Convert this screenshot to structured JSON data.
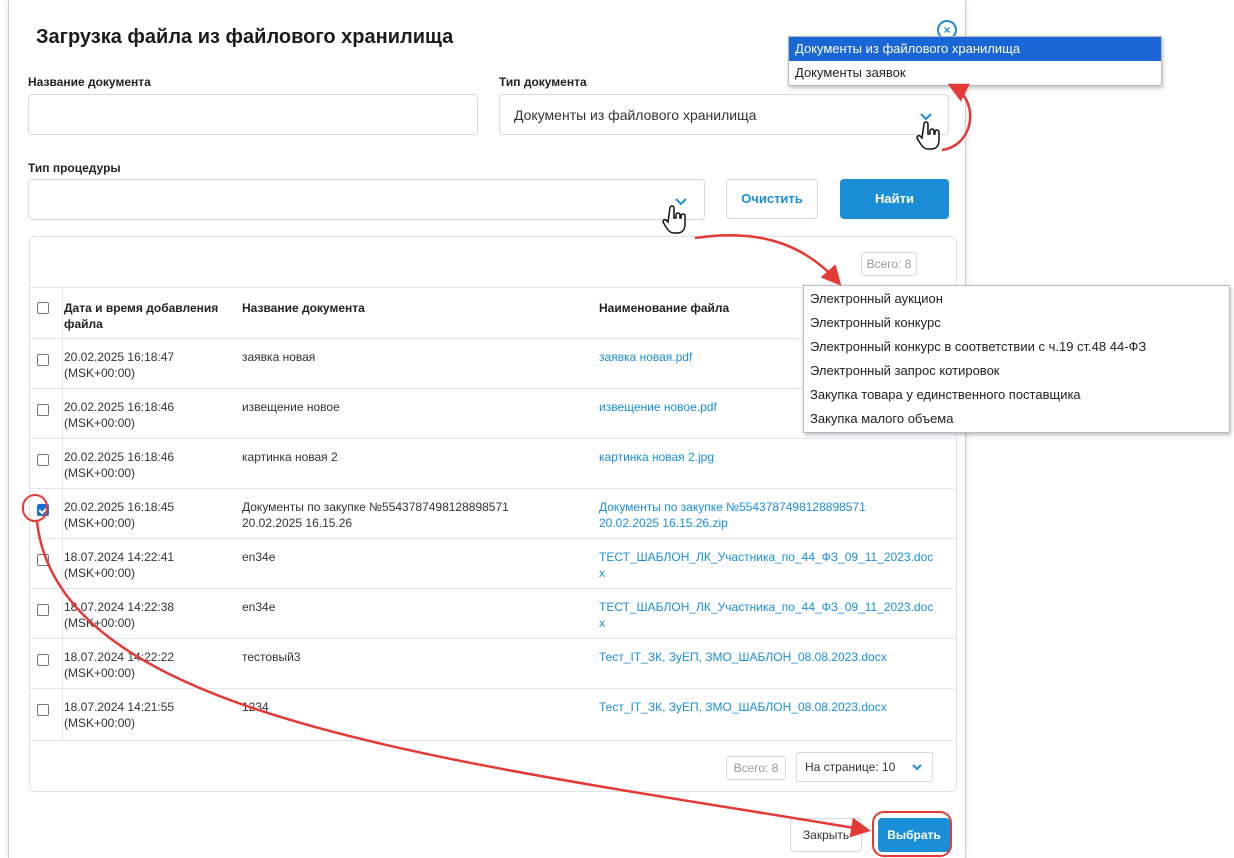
{
  "modal": {
    "title": "Загрузка файла из файлового хранилища",
    "close_icon": "close-circle-icon"
  },
  "filters": {
    "doc_name_label": "Название документа",
    "doc_name_value": "",
    "doc_type_label": "Тип документа",
    "doc_type_value": "Документы из файлового хранилища",
    "proc_type_label": "Тип процедуры",
    "proc_type_value": "",
    "clear_label": "Очистить",
    "find_label": "Найти"
  },
  "table": {
    "total_top": "Всего: 8",
    "headers": [
      "Дата и время добавления файла",
      "Название документа",
      "Наименование файла"
    ],
    "rows": [
      {
        "checked": false,
        "date": "20.02.2025 16:18:47",
        "tz": "(MSK+00:00)",
        "name": "заявка новая",
        "name2": "",
        "file": "заявка новая.pdf",
        "file2": ""
      },
      {
        "checked": false,
        "date": "20.02.2025 16:18:46",
        "tz": "(MSK+00:00)",
        "name": "извещение новое",
        "name2": "",
        "file": "извещение новое.pdf",
        "file2": ""
      },
      {
        "checked": false,
        "date": "20.02.2025 16:18:46",
        "tz": "(MSK+00:00)",
        "name": "картинка новая 2",
        "name2": "",
        "file": "картинка новая 2.jpg",
        "file2": ""
      },
      {
        "checked": true,
        "date": "20.02.2025 16:18:45",
        "tz": "(MSK+00:00)",
        "name": "Документы по закупке №5543787498128898571",
        "name2": "20.02.2025 16.15.26",
        "file": "Документы по закупке №5543787498128898571",
        "file2": "20.02.2025 16.15.26.zip"
      },
      {
        "checked": false,
        "date": "18.07.2024 14:22:41",
        "tz": "(MSK+00:00)",
        "name": "en34e",
        "name2": "",
        "file": "ТЕСТ_ШАБЛОН_ЛК_Участника_по_44_ФЗ_09_11_2023.doc",
        "file2": "x"
      },
      {
        "checked": false,
        "date": "18.07.2024 14:22:38",
        "tz": "(MSK+00:00)",
        "name": "en34e",
        "name2": "",
        "file": "ТЕСТ_ШАБЛОН_ЛК_Участника_по_44_ФЗ_09_11_2023.doc",
        "file2": "x"
      },
      {
        "checked": false,
        "date": "18.07.2024 14:22:22",
        "tz": "(MSK+00:00)",
        "name": "тестовый3",
        "name2": "",
        "file": "Тест_IT_ЗК, ЗуЕП, ЗМО_ШАБЛОН_08.08.2023.docx",
        "file2": ""
      },
      {
        "checked": false,
        "date": "18.07.2024 14:21:55",
        "tz": "(MSK+00:00)",
        "name": "1234",
        "name2": "",
        "file": "Тест_IT_ЗК, ЗуЕП, ЗМО_ШАБЛОН_08.08.2023.docx",
        "file2": ""
      }
    ],
    "total_bottom": "Всего: 8",
    "page_size": "На странице: 10"
  },
  "footer": {
    "close_label": "Закрыть",
    "choose_label": "Выбрать"
  },
  "doc_type_dropdown": {
    "options": [
      "Документы из файлового хранилища",
      "Документы заявок"
    ],
    "selected": 0
  },
  "proc_type_dropdown": {
    "options": [
      "Электронный аукцион",
      "Электронный конкурс",
      "Электронный конкурс в соответствии с ч.19 ст.48 44-ФЗ",
      "Электронный запрос котировок",
      "Закупка товара у единственного поставщика",
      "Закупка малого объема"
    ]
  },
  "colors": {
    "accent": "#1a8fd8",
    "annotation": "#e53935",
    "selected_option": "#1a66d6"
  }
}
